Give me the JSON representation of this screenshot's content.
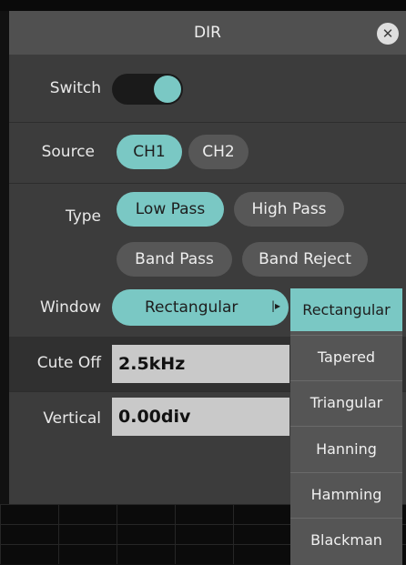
{
  "title": "DIR",
  "close_icon": "close-icon",
  "switch": {
    "label": "Switch",
    "state": "on"
  },
  "source": {
    "label": "Source",
    "options": [
      "CH1",
      "CH2"
    ],
    "selected": "CH1"
  },
  "type": {
    "label": "Type",
    "options": [
      "Low Pass",
      "High Pass",
      "Band Pass",
      "Band Reject"
    ],
    "selected": "Low Pass"
  },
  "window": {
    "label": "Window",
    "value": "Rectangular"
  },
  "cutoff": {
    "label": "Cute Off",
    "value": "2.5kHz"
  },
  "vertical": {
    "label": "Vertical",
    "value": "0.00div"
  },
  "window_menu": {
    "items": [
      "Rectangular",
      "Tapered",
      "Triangular",
      "Hanning",
      "Hamming",
      "Blackman"
    ],
    "selected": "Rectangular"
  },
  "colors": {
    "accent": "#7ac8c4",
    "panel": "#3c3c3c",
    "title_bar": "#505050"
  }
}
